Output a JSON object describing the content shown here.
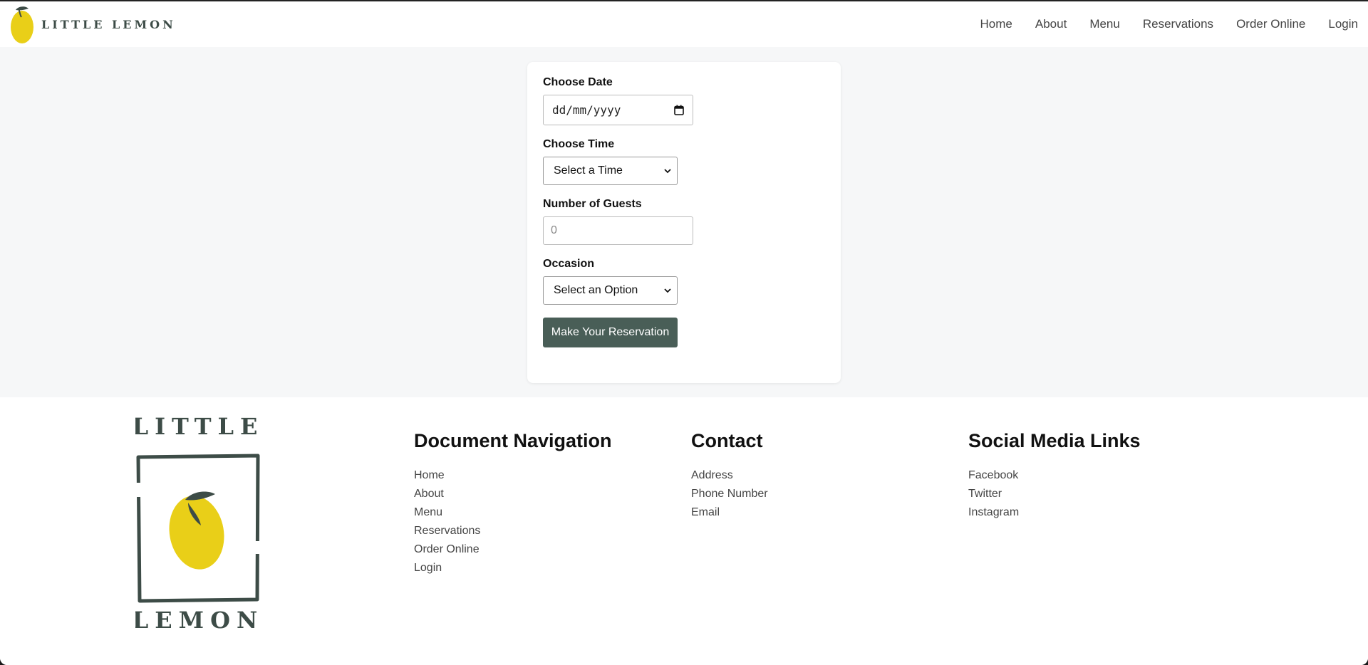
{
  "header": {
    "brand_name": "LITTLE LEMON",
    "nav": [
      "Home",
      "About",
      "Menu",
      "Reservations",
      "Order Online",
      "Login"
    ]
  },
  "form": {
    "date_label": "Choose Date",
    "date_placeholder": "dd/mm/yyyy",
    "time_label": "Choose Time",
    "time_selected": "Select a Time",
    "guests_label": "Number of Guests",
    "guests_placeholder": "0",
    "occasion_label": "Occasion",
    "occasion_selected": "Select an Option",
    "submit_label": "Make Your Reservation"
  },
  "footer": {
    "logo_top": "LITTLE",
    "logo_bottom": "LEMON",
    "columns": [
      {
        "title": "Document Navigation",
        "links": [
          "Home",
          "About",
          "Menu",
          "Reservations",
          "Order Online",
          "Login"
        ]
      },
      {
        "title": "Contact",
        "links": [
          "Address",
          "Phone Number",
          "Email"
        ]
      },
      {
        "title": "Social Media Links",
        "links": [
          "Facebook",
          "Twitter",
          "Instagram"
        ]
      }
    ]
  },
  "colors": {
    "brand_green": "#495e57",
    "lemon_yellow": "#e9cf18",
    "page_bg": "#f6f7f8"
  }
}
